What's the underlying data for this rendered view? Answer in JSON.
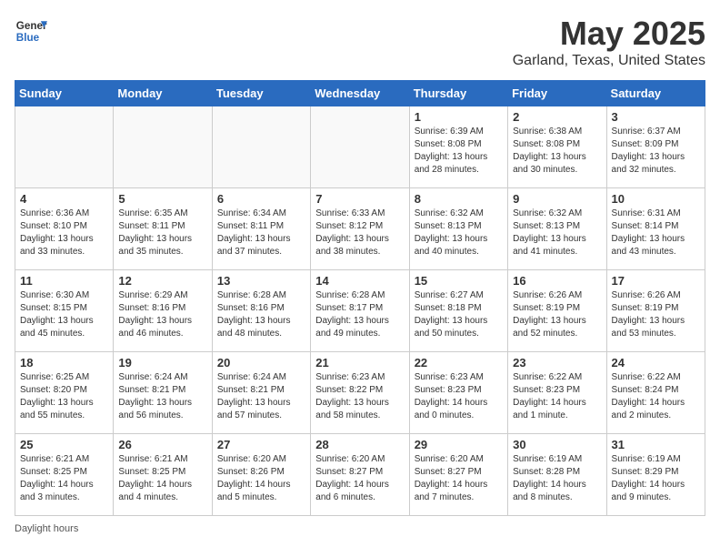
{
  "logo": {
    "line1": "General",
    "line2": "Blue"
  },
  "title": "May 2025",
  "subtitle": "Garland, Texas, United States",
  "days_of_week": [
    "Sunday",
    "Monday",
    "Tuesday",
    "Wednesday",
    "Thursday",
    "Friday",
    "Saturday"
  ],
  "footer": "Daylight hours",
  "weeks": [
    [
      {
        "day": "",
        "info": ""
      },
      {
        "day": "",
        "info": ""
      },
      {
        "day": "",
        "info": ""
      },
      {
        "day": "",
        "info": ""
      },
      {
        "day": "1",
        "info": "Sunrise: 6:39 AM\nSunset: 8:08 PM\nDaylight: 13 hours and 28 minutes."
      },
      {
        "day": "2",
        "info": "Sunrise: 6:38 AM\nSunset: 8:08 PM\nDaylight: 13 hours and 30 minutes."
      },
      {
        "day": "3",
        "info": "Sunrise: 6:37 AM\nSunset: 8:09 PM\nDaylight: 13 hours and 32 minutes."
      }
    ],
    [
      {
        "day": "4",
        "info": "Sunrise: 6:36 AM\nSunset: 8:10 PM\nDaylight: 13 hours and 33 minutes."
      },
      {
        "day": "5",
        "info": "Sunrise: 6:35 AM\nSunset: 8:11 PM\nDaylight: 13 hours and 35 minutes."
      },
      {
        "day": "6",
        "info": "Sunrise: 6:34 AM\nSunset: 8:11 PM\nDaylight: 13 hours and 37 minutes."
      },
      {
        "day": "7",
        "info": "Sunrise: 6:33 AM\nSunset: 8:12 PM\nDaylight: 13 hours and 38 minutes."
      },
      {
        "day": "8",
        "info": "Sunrise: 6:32 AM\nSunset: 8:13 PM\nDaylight: 13 hours and 40 minutes."
      },
      {
        "day": "9",
        "info": "Sunrise: 6:32 AM\nSunset: 8:13 PM\nDaylight: 13 hours and 41 minutes."
      },
      {
        "day": "10",
        "info": "Sunrise: 6:31 AM\nSunset: 8:14 PM\nDaylight: 13 hours and 43 minutes."
      }
    ],
    [
      {
        "day": "11",
        "info": "Sunrise: 6:30 AM\nSunset: 8:15 PM\nDaylight: 13 hours and 45 minutes."
      },
      {
        "day": "12",
        "info": "Sunrise: 6:29 AM\nSunset: 8:16 PM\nDaylight: 13 hours and 46 minutes."
      },
      {
        "day": "13",
        "info": "Sunrise: 6:28 AM\nSunset: 8:16 PM\nDaylight: 13 hours and 48 minutes."
      },
      {
        "day": "14",
        "info": "Sunrise: 6:28 AM\nSunset: 8:17 PM\nDaylight: 13 hours and 49 minutes."
      },
      {
        "day": "15",
        "info": "Sunrise: 6:27 AM\nSunset: 8:18 PM\nDaylight: 13 hours and 50 minutes."
      },
      {
        "day": "16",
        "info": "Sunrise: 6:26 AM\nSunset: 8:19 PM\nDaylight: 13 hours and 52 minutes."
      },
      {
        "day": "17",
        "info": "Sunrise: 6:26 AM\nSunset: 8:19 PM\nDaylight: 13 hours and 53 minutes."
      }
    ],
    [
      {
        "day": "18",
        "info": "Sunrise: 6:25 AM\nSunset: 8:20 PM\nDaylight: 13 hours and 55 minutes."
      },
      {
        "day": "19",
        "info": "Sunrise: 6:24 AM\nSunset: 8:21 PM\nDaylight: 13 hours and 56 minutes."
      },
      {
        "day": "20",
        "info": "Sunrise: 6:24 AM\nSunset: 8:21 PM\nDaylight: 13 hours and 57 minutes."
      },
      {
        "day": "21",
        "info": "Sunrise: 6:23 AM\nSunset: 8:22 PM\nDaylight: 13 hours and 58 minutes."
      },
      {
        "day": "22",
        "info": "Sunrise: 6:23 AM\nSunset: 8:23 PM\nDaylight: 14 hours and 0 minutes."
      },
      {
        "day": "23",
        "info": "Sunrise: 6:22 AM\nSunset: 8:23 PM\nDaylight: 14 hours and 1 minute."
      },
      {
        "day": "24",
        "info": "Sunrise: 6:22 AM\nSunset: 8:24 PM\nDaylight: 14 hours and 2 minutes."
      }
    ],
    [
      {
        "day": "25",
        "info": "Sunrise: 6:21 AM\nSunset: 8:25 PM\nDaylight: 14 hours and 3 minutes."
      },
      {
        "day": "26",
        "info": "Sunrise: 6:21 AM\nSunset: 8:25 PM\nDaylight: 14 hours and 4 minutes."
      },
      {
        "day": "27",
        "info": "Sunrise: 6:20 AM\nSunset: 8:26 PM\nDaylight: 14 hours and 5 minutes."
      },
      {
        "day": "28",
        "info": "Sunrise: 6:20 AM\nSunset: 8:27 PM\nDaylight: 14 hours and 6 minutes."
      },
      {
        "day": "29",
        "info": "Sunrise: 6:20 AM\nSunset: 8:27 PM\nDaylight: 14 hours and 7 minutes."
      },
      {
        "day": "30",
        "info": "Sunrise: 6:19 AM\nSunset: 8:28 PM\nDaylight: 14 hours and 8 minutes."
      },
      {
        "day": "31",
        "info": "Sunrise: 6:19 AM\nSunset: 8:29 PM\nDaylight: 14 hours and 9 minutes."
      }
    ]
  ]
}
